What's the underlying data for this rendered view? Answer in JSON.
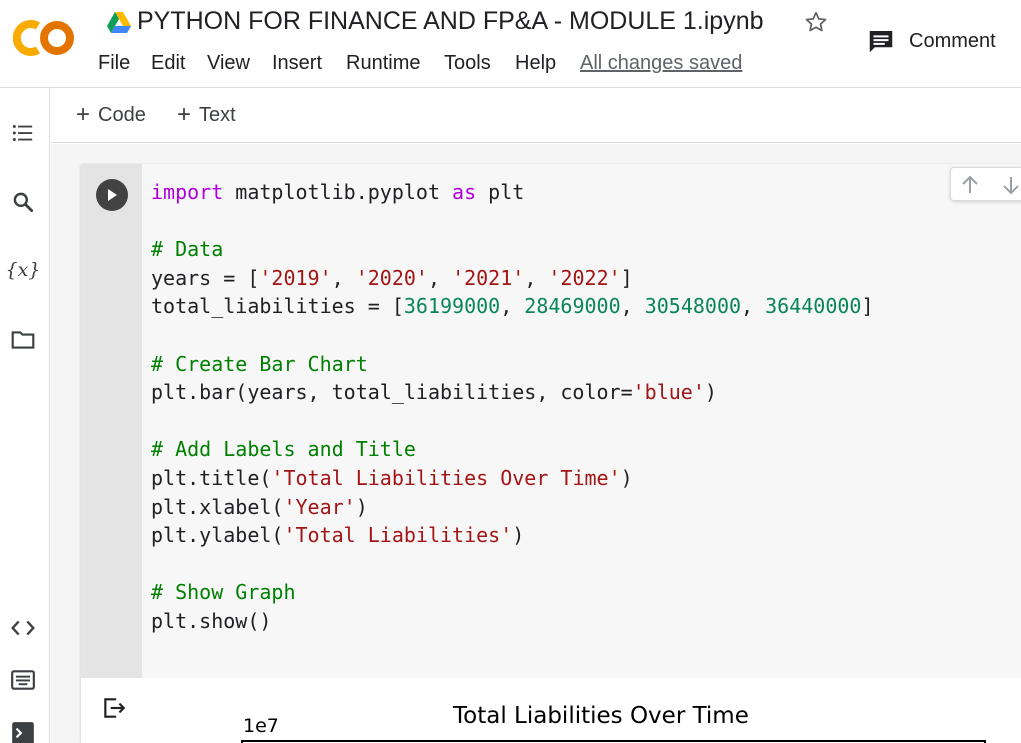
{
  "app": {
    "logo_text": "CO",
    "notebook_title": "PYTHON FOR FINANCE AND FP&A - MODULE 1.ipynb",
    "comment_label": "Comment",
    "save_status": "All changes saved"
  },
  "menu": [
    "File",
    "Edit",
    "View",
    "Insert",
    "Runtime",
    "Tools",
    "Help"
  ],
  "sidebar": {
    "icons": [
      "table-of-contents-icon",
      "search-icon",
      "variables-icon",
      "files-icon",
      "code-snippets-icon",
      "command-palette-icon",
      "terminal-icon"
    ],
    "variables_glyph": "{x}"
  },
  "toolbar": {
    "add_code": "Code",
    "add_text": "Text"
  },
  "cell": {
    "code_lines": [
      "import matplotlib.pyplot as plt",
      "",
      "# Data",
      "years = ['2019', '2020', '2021', '2022']",
      "total_liabilities = [36199000, 28469000, 30548000, 36440000]",
      "",
      "# Create Bar Chart",
      "plt.bar(years, total_liabilities, color='blue')",
      "",
      "# Add Labels and Title",
      "plt.title('Total Liabilities Over Time')",
      "plt.xlabel('Year')",
      "plt.ylabel('Total Liabilities')",
      "",
      "# Show Graph",
      "plt.show()"
    ]
  },
  "output": {
    "chart_title": "Total Liabilities Over Time",
    "axis_exponent": "1e7"
  },
  "colors": {
    "keyword": "#af00db",
    "comment": "#008000",
    "string": "#a31515",
    "number": "#098658",
    "logo_orange": "#f9ab00",
    "logo_orange_dark": "#e37400"
  }
}
